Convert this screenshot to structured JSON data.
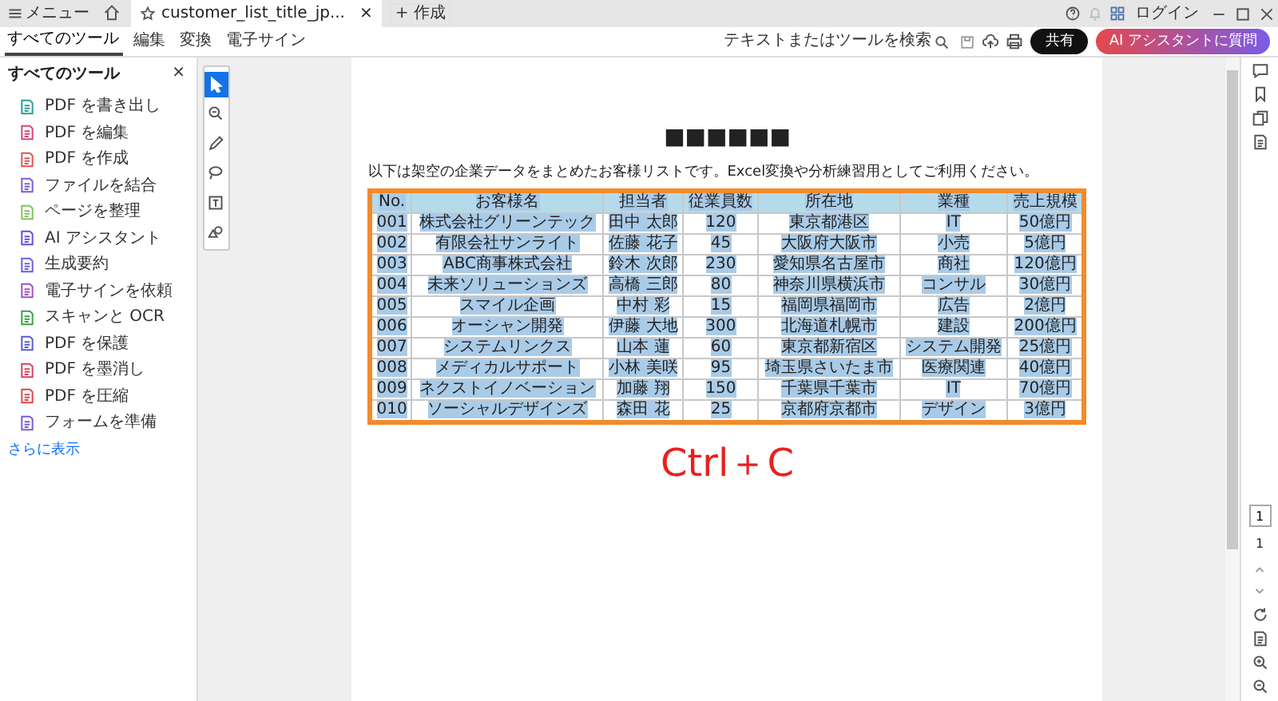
{
  "title_bar": {
    "menu": "メニュー",
    "tab": {
      "label": "customer_list_title_jp...",
      "close": "×"
    },
    "create": "+ 作成",
    "login": "ログイン"
  },
  "toolbar": {
    "tabs": [
      {
        "label": "すべてのツール",
        "selected": true
      },
      {
        "label": "編集",
        "selected": false
      },
      {
        "label": "変換",
        "selected": false
      },
      {
        "label": "電子サイン",
        "selected": false
      }
    ],
    "search_label": "テキストまたはツールを検索",
    "share": "共有",
    "ai_button": "AI アシスタントに質問"
  },
  "sidebar": {
    "title": "すべてのツール",
    "close": "×",
    "items": [
      {
        "label": "PDF を書き出し",
        "color": "#2a9d9a"
      },
      {
        "label": "PDF を編集",
        "color": "#d8427a"
      },
      {
        "label": "PDF を作成",
        "color": "#e05252"
      },
      {
        "label": "ファイルを結合",
        "color": "#7b5cd6"
      },
      {
        "label": "ページを整理",
        "color": "#7cc45a"
      },
      {
        "label": "AI アシスタント",
        "color": "#6a4cd6"
      },
      {
        "label": "生成要約",
        "color": "#6a5ce0"
      },
      {
        "label": "電子サインを依頼",
        "color": "#a050c8"
      },
      {
        "label": "スキャンと OCR",
        "color": "#3aa04a"
      },
      {
        "label": "PDF を保護",
        "color": "#5a5ad6"
      },
      {
        "label": "PDF を墨消し",
        "color": "#d84060"
      },
      {
        "label": "PDF を圧縮",
        "color": "#d84848"
      },
      {
        "label": "フォームを準備",
        "color": "#7a5cd6"
      }
    ],
    "more": "さらに表示"
  },
  "tools": [
    {
      "selected": true
    },
    {
      "selected": false
    },
    {
      "selected": false
    },
    {
      "selected": false
    },
    {
      "selected": false
    },
    {
      "selected": false
    }
  ],
  "document": {
    "heading": "■■■■■■",
    "description": "以下は架空の企業データをまとめたお客様リストです。Excel変換や分析練習用としてご利用ください。",
    "table": {
      "selected": true,
      "columns": [
        "No.",
        "お客様名",
        "担当者",
        "従業員数",
        "所在地",
        "業種",
        "売上規模"
      ],
      "rows": [
        [
          "001",
          "株式会社グリーンテック",
          "田中 太郎",
          "120",
          "東京都港区",
          "IT",
          "50億円"
        ],
        [
          "002",
          "有限会社サンライト",
          "佐藤 花子",
          "45",
          "大阪府大阪市",
          "小売",
          "5億円"
        ],
        [
          "003",
          "ABC商事株式会社",
          "鈴木 次郎",
          "230",
          "愛知県名古屋市",
          "商社",
          "120億円"
        ],
        [
          "004",
          "未来ソリューションズ",
          "高橋 三郎",
          "80",
          "神奈川県横浜市",
          "コンサル",
          "30億円"
        ],
        [
          "005",
          "スマイル企画",
          "中村 彩",
          "15",
          "福岡県福岡市",
          "広告",
          "2億円"
        ],
        [
          "006",
          "オーシャン開発",
          "伊藤 大地",
          "300",
          "北海道札幌市",
          "建設",
          "200億円"
        ],
        [
          "007",
          "システムリンクス",
          "山本 蓮",
          "60",
          "東京都新宿区",
          "システム開発",
          "25億円"
        ],
        [
          "008",
          "メディカルサポート",
          "小林 美咲",
          "95",
          "埼玉県さいたま市",
          "医療関連",
          "40億円"
        ],
        [
          "009",
          "ネクストイノベーション",
          "加藤 翔",
          "150",
          "千葉県千葉市",
          "IT",
          "70億円"
        ],
        [
          "010",
          "ソーシャルデザインズ",
          "森田 花",
          "25",
          "京都府京都市",
          "デザイン",
          "3億円"
        ]
      ]
    }
  },
  "overlay_text": "Ctrl＋C",
  "page_nav": {
    "current": "1",
    "total": "1"
  }
}
